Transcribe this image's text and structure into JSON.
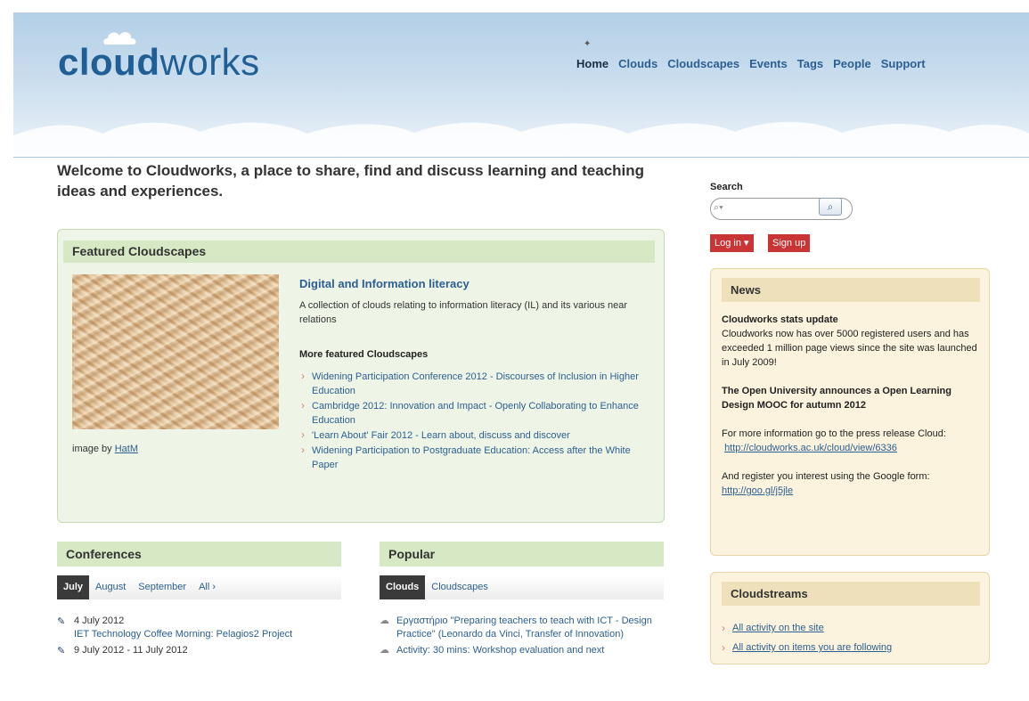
{
  "header": {
    "logo_bold": "cloud",
    "logo_light": "works",
    "nav": [
      {
        "label": "Home"
      },
      {
        "label": "Clouds"
      },
      {
        "label": "Cloudscapes"
      },
      {
        "label": "Events"
      },
      {
        "label": "Tags"
      },
      {
        "label": "People"
      },
      {
        "label": "Support"
      }
    ]
  },
  "welcome": "Welcome to Cloudworks, a place to share, find and discuss learning and teaching ideas and experiences.",
  "featured": {
    "heading": "Featured Cloudscapes",
    "image_credit_prefix": "image by",
    "image_credit_link": "HatM",
    "title": "Digital and Information literacy",
    "description": "A collection of clouds relating to information literacy (IL) and its various near relations",
    "more_heading": "More featured Cloudscapes",
    "more": [
      "Widening Participation Conference 2012 - Discourses of Inclusion in Higher Education",
      "Cambridge 2012: Innovation and Impact - Openly Collaborating to Enhance Education",
      "'Learn About' Fair 2012 - Learn about, discuss and discover",
      "Widening Participation to Postgraduate Education: Access after the White Paper"
    ]
  },
  "conferences": {
    "heading": "Conferences",
    "tabs": [
      "July",
      "August",
      "September",
      "All ›"
    ],
    "events": [
      {
        "date": "4 July 2012",
        "title": "IET Technology Coffee Morning: Pelagios2 Project"
      },
      {
        "date": "9 July 2012 - 11 July 2012",
        "title": ""
      }
    ]
  },
  "popular": {
    "heading": "Popular",
    "tabs": [
      "Clouds",
      "Cloudscapes"
    ],
    "items": [
      "Εργαστήριο \"Preparing teachers to teach with ICT - Design Practice\" (Leonardo da Vinci, Transfer of Innovation)",
      "Activity: 30 mins: Workshop evaluation and next"
    ]
  },
  "search": {
    "label": "Search",
    "placeholder": "",
    "button_icon": "search-icon"
  },
  "auth": {
    "login": "Log in ▾",
    "signup": "Sign up"
  },
  "news": {
    "heading": "News",
    "item1_title": "Cloudworks stats update",
    "item1_body": "Cloudworks now has over 5000 registered users and has exceeded 1 million page views since the site was launched in July 2009!",
    "item2_title": "The Open University announces a Open Learning Design MOOC for autumn 2012",
    "item3_text": "For more information go to the press release Cloud:",
    "item3_link": "http://cloudworks.ac.uk/cloud/view/6336",
    "item4_text": "And register you interest using the Google form:",
    "item4_link": "http://goo.gl/j5jle"
  },
  "cloudstreams": {
    "heading": "Cloudstreams",
    "links": [
      "All activity on the site",
      "All activity on items you are following"
    ]
  },
  "colors": {
    "link": "#2c5f93",
    "featured_bg": "#eef5e6",
    "news_bg": "#fbf3dd",
    "button_red": "#c93434"
  }
}
